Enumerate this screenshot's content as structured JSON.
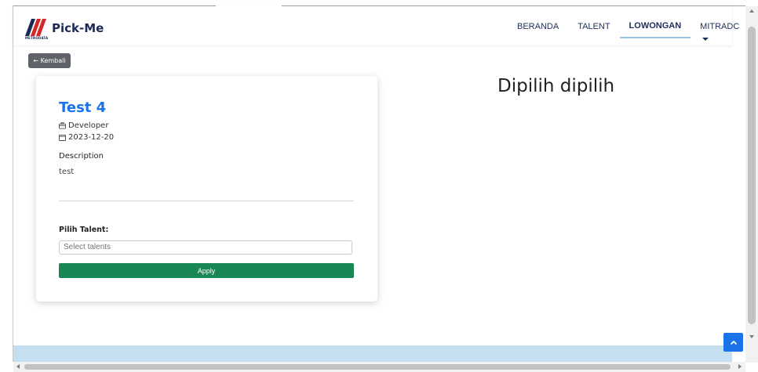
{
  "brand": {
    "name": "Pick-Me",
    "sub": "METRODATA"
  },
  "nav": {
    "items": [
      {
        "label": "BERANDA"
      },
      {
        "label": "TALENT"
      },
      {
        "label": "LOWONGAN"
      },
      {
        "label": "MITRADC"
      }
    ],
    "active_index": 2
  },
  "back_button": {
    "label": "← Kembali"
  },
  "job": {
    "title": "Test 4",
    "role": "Developer",
    "date": "2023-12-20",
    "description_label": "Description",
    "description": "test"
  },
  "talent_form": {
    "label": "Pilih Talent:",
    "placeholder": "Select talents",
    "apply_label": "Apply"
  },
  "right_panel": {
    "heading": "Dipilih dipilih"
  },
  "colors": {
    "accent_blue": "#1a73e8",
    "apply_green": "#198754",
    "footer_band": "#c3dff0",
    "back_button_bg": "#5f6268",
    "nav_active_underline": "#9bc7e6"
  },
  "icons": [
    "briefcase-icon",
    "calendar-icon",
    "chevron-up-icon",
    "caret-down-icon"
  ]
}
